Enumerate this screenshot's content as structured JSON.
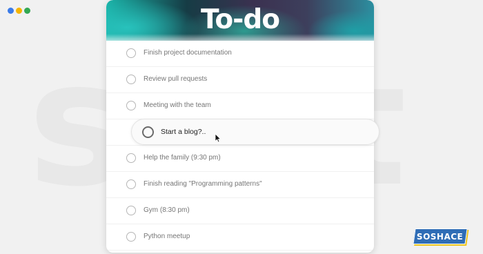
{
  "window_dots": [
    {
      "name": "blue",
      "color": "#3b7be8"
    },
    {
      "name": "yellow",
      "color": "#f5b400"
    },
    {
      "name": "green",
      "color": "#33a852"
    }
  ],
  "header": {
    "title": "To-do"
  },
  "tasks": [
    {
      "label": "Finish project documentation",
      "checked": false
    },
    {
      "label": "Review pull requests",
      "checked": false
    },
    {
      "label": "Meeting with the team",
      "checked": false
    },
    {
      "label": "Help the family (9:30 pm)",
      "checked": false
    },
    {
      "label": "Finish reading \"Programming patterns\"",
      "checked": false
    },
    {
      "label": "Gym (8:30 pm)",
      "checked": false
    },
    {
      "label": "Python meetup",
      "checked": false
    }
  ],
  "active_task": {
    "label": "Start a blog?..",
    "checked": false
  },
  "brand": {
    "logo_text": "SOSHACE",
    "primary_color": "#2f6db6",
    "accent_color": "#f0c419"
  }
}
